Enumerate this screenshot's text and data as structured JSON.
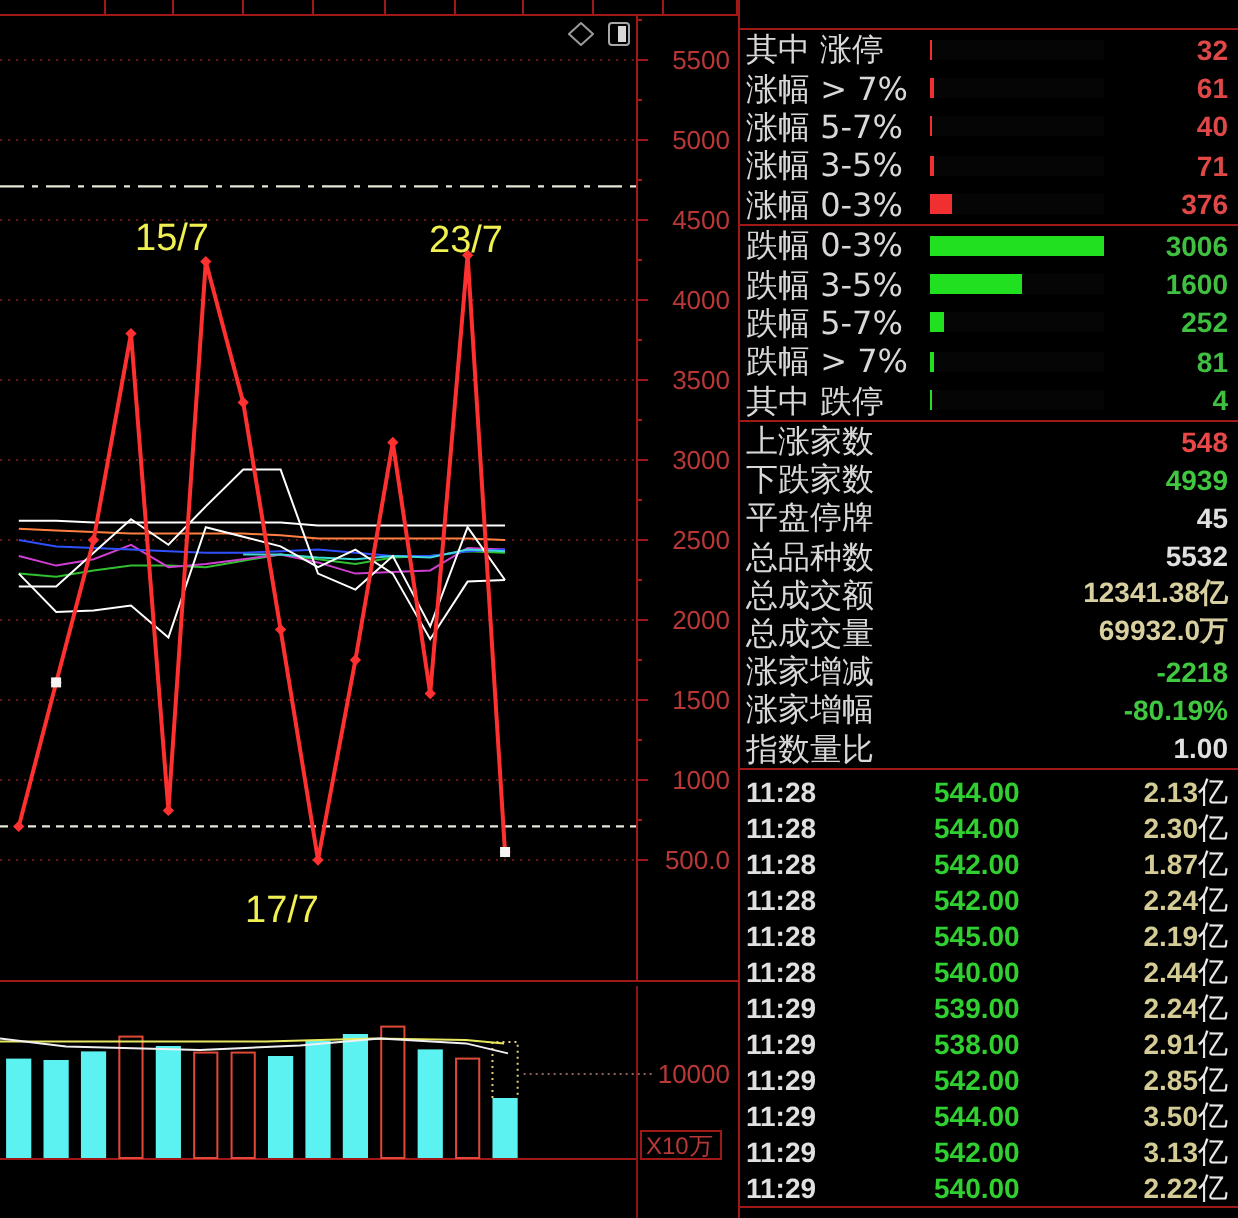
{
  "chart": {
    "chart_data": {
      "type": "line",
      "grid": true,
      "ylim": [
        -250,
        5775
      ],
      "yticks": [
        {
          "value": 500,
          "label": "500.0"
        },
        1000,
        1500,
        2000,
        2500,
        3000,
        3500,
        4000,
        4500,
        5000,
        5500
      ],
      "series": [
        {
          "color": "#30c030",
          "values": [
            2290,
            2270,
            2310,
            2340,
            2340,
            2330,
            2370,
            2410,
            2380,
            2350,
            2390,
            2400,
            2430,
            2420,
            null,
            null,
            null
          ]
        },
        {
          "color": "#d040d0",
          "values": [
            2400,
            2340,
            2380,
            2470,
            2330,
            2350,
            2380,
            2410,
            2360,
            2290,
            2300,
            2310,
            2450,
            2440,
            null,
            null,
            null
          ]
        },
        {
          "color": "#3050ff",
          "values": [
            2500,
            2460,
            2450,
            2440,
            2430,
            2420,
            2420,
            2430,
            2440,
            2420,
            2400,
            2400,
            2430,
            2440,
            null,
            null,
            null
          ]
        },
        {
          "color": "#40d8d8",
          "values": [
            null,
            null,
            null,
            null,
            null,
            null,
            2410,
            2410,
            2390,
            2380,
            2400,
            2390,
            2440,
            2430,
            null,
            null,
            null
          ]
        },
        {
          "color": "#ff8040",
          "values": [
            2570,
            2560,
            2550,
            2540,
            2540,
            2540,
            2540,
            2530,
            2510,
            2510,
            2510,
            2510,
            2510,
            2500,
            null,
            null,
            null
          ]
        },
        {
          "color": "#ffffff",
          "values": [
            2620,
            2620,
            2610,
            2610,
            2610,
            2610,
            2610,
            2610,
            2590,
            2590,
            2590,
            2590,
            2590,
            2590,
            null,
            null,
            null
          ]
        },
        {
          "color": "#ffffff",
          "values": [
            2210,
            2210,
            2420,
            2630,
            2470,
            2710,
            2940,
            2940,
            2290,
            2190,
            2400,
            1960,
            2580,
            2250,
            null,
            null,
            null
          ]
        },
        {
          "color": "#ffffff",
          "values": [
            2290,
            2050,
            2060,
            2090,
            1890,
            2580,
            2520,
            2460,
            2330,
            2440,
            2290,
            1880,
            2240,
            2250,
            null,
            null,
            null
          ]
        },
        {
          "color": "#ff3030",
          "marker": "diamond",
          "values": [
            710,
            1610,
            2500,
            3790,
            810,
            4240,
            3360,
            1940,
            500,
            1750,
            3110,
            1540,
            4280,
            550,
            null,
            null,
            null
          ]
        }
      ],
      "ref_lines": [
        {
          "axis": "y",
          "value": 4710
        },
        {
          "axis": "y",
          "value": 710
        }
      ],
      "annotations": [
        "15/7",
        "23/7",
        "17/7"
      ]
    }
  },
  "volume_chart": {
    "axis_label": "10000",
    "unit": "X10万"
  },
  "breadth": {
    "rises": [
      {
        "label": "其中 涨停",
        "count": "32",
        "level": 0.011
      },
      {
        "label": "涨幅 > 7%",
        "count": "61",
        "level": 0.02
      },
      {
        "label": "涨幅 5-7%",
        "count": "40",
        "level": 0.013
      },
      {
        "label": "涨幅 3-5%",
        "count": "71",
        "level": 0.024
      },
      {
        "label": "涨幅 0-3%",
        "count": "376",
        "level": 0.125
      }
    ],
    "falls": [
      {
        "label": "跌幅 0-3%",
        "count": "3006",
        "level": 1
      },
      {
        "label": "跌幅 3-5%",
        "count": "1600",
        "level": 0.532
      },
      {
        "label": "跌幅 5-7%",
        "count": "252",
        "level": 0.084
      },
      {
        "label": "跌幅 > 7%",
        "count": "81",
        "level": 0.027
      },
      {
        "label": "其中 跌停",
        "count": "4",
        "level": 0.001
      }
    ]
  },
  "summary": [
    {
      "label": "上涨家数",
      "value": "548",
      "color": "#e84848"
    },
    {
      "label": "下跌家数",
      "value": "4939",
      "color": "#40c840"
    },
    {
      "label": "平盘停牌",
      "value": "45",
      "color": "#e0e0e0"
    },
    {
      "label": "总品种数",
      "value": "5532",
      "color": "#e0e0e0"
    },
    {
      "label": "总成交额",
      "value": "12341.38亿",
      "color": "#d8d0a0"
    },
    {
      "label": "总成交量",
      "value": "69932.0万",
      "color": "#d8d0a0"
    },
    {
      "label": "涨家增减",
      "value": "-2218",
      "color": "#40c840"
    },
    {
      "label": "涨家增幅",
      "value": "-80.19%",
      "color": "#40c840"
    },
    {
      "label": "指数量比",
      "value": "1.00",
      "color": "#e0e0e0"
    }
  ],
  "ticks": [
    {
      "time": "11:28",
      "price": "544.00",
      "amount": "2.13",
      "unit": "亿"
    },
    {
      "time": "11:28",
      "price": "544.00",
      "amount": "2.30",
      "unit": "亿"
    },
    {
      "time": "11:28",
      "price": "542.00",
      "amount": "1.87",
      "unit": "亿"
    },
    {
      "time": "11:28",
      "price": "542.00",
      "amount": "2.24",
      "unit": "亿"
    },
    {
      "time": "11:28",
      "price": "545.00",
      "amount": "2.19",
      "unit": "亿"
    },
    {
      "time": "11:28",
      "price": "540.00",
      "amount": "2.44",
      "unit": "亿"
    },
    {
      "time": "11:29",
      "price": "539.00",
      "amount": "2.24",
      "unit": "亿"
    },
    {
      "time": "11:29",
      "price": "538.00",
      "amount": "2.91",
      "unit": "亿"
    },
    {
      "time": "11:29",
      "price": "542.00",
      "amount": "2.85",
      "unit": "亿"
    },
    {
      "time": "11:29",
      "price": "544.00",
      "amount": "3.50",
      "unit": "亿"
    },
    {
      "time": "11:29",
      "price": "542.00",
      "amount": "3.13",
      "unit": "亿"
    },
    {
      "time": "11:29",
      "price": "540.00",
      "amount": "2.22",
      "unit": "亿"
    }
  ]
}
